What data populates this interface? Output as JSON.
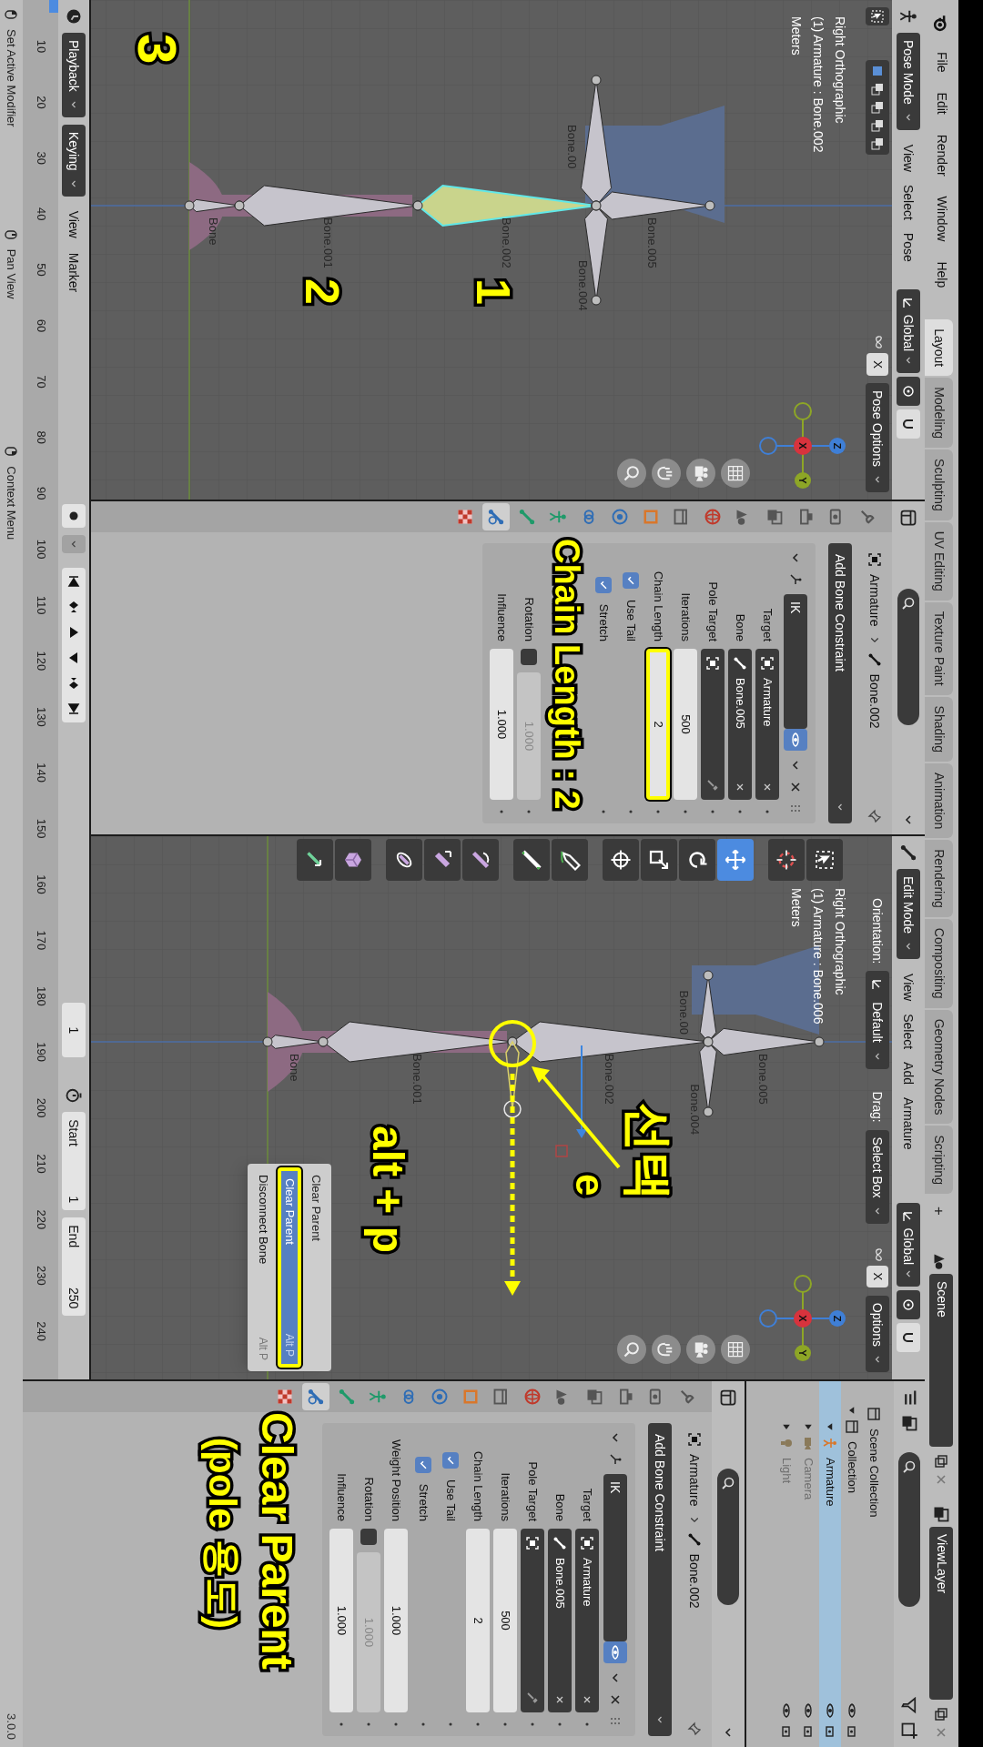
{
  "top_bar": {
    "menus": [
      "File",
      "Edit",
      "Render",
      "Window",
      "Help"
    ],
    "workspaces": [
      {
        "label": "Layout",
        "selected": true
      },
      {
        "label": "Modeling",
        "selected": false
      },
      {
        "label": "Sculpting",
        "selected": false
      },
      {
        "label": "UV Editing",
        "selected": false
      },
      {
        "label": "Texture Paint",
        "selected": false
      },
      {
        "label": "Shading",
        "selected": false
      },
      {
        "label": "Animation",
        "selected": false
      },
      {
        "label": "Rendering",
        "selected": false
      },
      {
        "label": "Compositing",
        "selected": false
      },
      {
        "label": "Geometry Nodes",
        "selected": false
      },
      {
        "label": "Scripting",
        "selected": false
      }
    ],
    "add_workspace": "+",
    "scene": "Scene",
    "view_layer": "ViewLayer"
  },
  "viewports": [
    {
      "mode": "Pose Mode",
      "menus": [
        "View",
        "Select",
        "Pose"
      ],
      "orientation": "Global",
      "mirror": "X",
      "options": "Pose Options",
      "overlay": [
        "Right Orthographic",
        "(1) Armature : Bone.002",
        "Meters"
      ],
      "bones": [
        {
          "label": "Bone",
          "selected": false
        },
        {
          "label": "Bone.001",
          "selected": false
        },
        {
          "label": "Bone.002",
          "selected": true
        },
        {
          "label": "Bone.00",
          "selected": false
        },
        {
          "label": "Bone.004",
          "selected": false
        },
        {
          "label": "Bone.005",
          "selected": false
        }
      ],
      "extruded_bone": false,
      "gizmo": [
        "X",
        "Y",
        "Z"
      ]
    },
    {
      "mode": "Edit Mode",
      "menus": [
        "View",
        "Select",
        "Add",
        "Armature"
      ],
      "orientation": "Global",
      "mirror": "X",
      "options": "Options",
      "tool_settings": {
        "orientation_label": "Orientation:",
        "orientation": "Default",
        "drag_label": "Drag:",
        "drag": "Select Box"
      },
      "overlay": [
        "Right Orthographic",
        "(1) Armature : Bone.006",
        "Meters"
      ],
      "bones": [
        {
          "label": "Bone",
          "selected": false
        },
        {
          "label": "Bone.001",
          "selected": false
        },
        {
          "label": "Bone.002",
          "selected": false
        },
        {
          "label": "Bone.00",
          "selected": false
        },
        {
          "label": "Bone.004",
          "selected": false
        },
        {
          "label": "Bone.005",
          "selected": false
        }
      ],
      "extruded_bone": true,
      "gizmo": [
        "X",
        "Y",
        "Z"
      ],
      "toolbar": [
        {
          "kind": "select",
          "selected": false
        },
        {
          "kind": "cursor",
          "selected": false
        },
        {
          "kind": "move",
          "selected": true
        },
        {
          "kind": "rotate",
          "selected": false
        },
        {
          "kind": "scale",
          "selected": false
        },
        {
          "kind": "transform",
          "selected": false
        },
        {
          "kind": "annotate",
          "selected": false
        },
        {
          "kind": "measure",
          "selected": false
        },
        {
          "kind": "roll",
          "selected": false
        },
        {
          "kind": "bone_size",
          "selected": false
        },
        {
          "kind": "envelope",
          "selected": false
        },
        {
          "kind": "extrude",
          "selected": false
        },
        {
          "kind": "extrude_cursor",
          "selected": false
        }
      ],
      "popup": {
        "title": "Clear Parent",
        "items": [
          {
            "label": "Clear Parent",
            "shortcut": "Alt P",
            "selected": true,
            "highlighted": true
          },
          {
            "label": "Disconnect Bone",
            "shortcut": "Alt P",
            "selected": false,
            "highlighted": false
          }
        ]
      }
    }
  ],
  "properties": [
    {
      "breadcrumb": [
        "Armature",
        "Bone.002"
      ],
      "add_button": "Add Bone Constraint",
      "constraint_name": "IK",
      "tabs": [
        {
          "kind": "tool",
          "selected": false
        },
        {
          "kind": "render",
          "selected": false
        },
        {
          "kind": "output",
          "selected": false
        },
        {
          "kind": "view_layer",
          "selected": false
        },
        {
          "kind": "scene",
          "selected": false
        },
        {
          "kind": "world",
          "selected": false
        },
        {
          "kind": "collection",
          "selected": false
        },
        {
          "kind": "object",
          "selected": false
        },
        {
          "kind": "physics",
          "selected": false
        },
        {
          "kind": "object_constraint",
          "selected": false
        },
        {
          "kind": "data",
          "selected": false
        },
        {
          "kind": "bone",
          "selected": false
        },
        {
          "kind": "bone_constraint",
          "selected": true
        },
        {
          "kind": "texture",
          "selected": false
        }
      ],
      "fields": [
        {
          "kind": "object",
          "label": "Target",
          "value": "Armature",
          "highlighted": false
        },
        {
          "kind": "bone",
          "label": "Bone",
          "value": "Bone.005",
          "highlighted": false
        },
        {
          "kind": "object",
          "label": "Pole Target",
          "highlighted": false
        },
        {
          "kind": "number",
          "label": "Iterations",
          "value": "500",
          "highlighted": false
        },
        {
          "kind": "number",
          "label": "Chain Length",
          "value": "2",
          "highlighted": true
        },
        {
          "kind": "check",
          "label": "Use Tail",
          "checked": true
        },
        {
          "kind": "check",
          "label": "Stretch",
          "checked": true
        },
        {
          "kind": "check_number",
          "label": "Rotation",
          "checked": false,
          "value": "1.000",
          "disabled": true
        },
        {
          "kind": "number",
          "label": "Influence",
          "value": "1.000",
          "highlighted": false
        }
      ]
    },
    {
      "breadcrumb": [
        "Armature",
        "Bone.002"
      ],
      "add_button": "Add Bone Constraint",
      "constraint_name": "IK",
      "tabs": [
        {
          "kind": "tool",
          "selected": false
        },
        {
          "kind": "render",
          "selected": false
        },
        {
          "kind": "output",
          "selected": false
        },
        {
          "kind": "view_layer",
          "selected": false
        },
        {
          "kind": "scene",
          "selected": false
        },
        {
          "kind": "world",
          "selected": false
        },
        {
          "kind": "collection",
          "selected": false
        },
        {
          "kind": "object",
          "selected": false
        },
        {
          "kind": "physics",
          "selected": false
        },
        {
          "kind": "object_constraint",
          "selected": false
        },
        {
          "kind": "data",
          "selected": false
        },
        {
          "kind": "bone",
          "selected": false
        },
        {
          "kind": "bone_constraint",
          "selected": true
        },
        {
          "kind": "texture",
          "selected": false
        }
      ],
      "fields": [
        {
          "kind": "object",
          "label": "Target",
          "value": "Armature",
          "highlighted": false
        },
        {
          "kind": "bone",
          "label": "Bone",
          "value": "Bone.005",
          "highlighted": false
        },
        {
          "kind": "object",
          "label": "Pole Target",
          "highlighted": false
        },
        {
          "kind": "number",
          "label": "Iterations",
          "value": "500",
          "highlighted": false
        },
        {
          "kind": "number",
          "label": "Chain Length",
          "value": "2",
          "highlighted": false
        },
        {
          "kind": "check",
          "label": "Use Tail",
          "checked": true
        },
        {
          "kind": "check",
          "label": "Stretch",
          "checked": true
        },
        {
          "kind": "number",
          "label": "Weight Position",
          "value": "1.000",
          "highlighted": false
        },
        {
          "kind": "check_number",
          "label": "Rotation",
          "checked": false,
          "value": "1.000",
          "disabled": true
        },
        {
          "kind": "number",
          "label": "Influence",
          "value": "1.000",
          "highlighted": false
        }
      ]
    }
  ],
  "outliner": {
    "tree": [
      {
        "label": "Scene Collection",
        "children": [
          {
            "label": "Collection",
            "expanded": true,
            "children": [
              {
                "label": "Armature",
                "expanded": true,
                "selected": true,
                "disabled": false
              },
              {
                "label": "Camera",
                "expanded": false,
                "selected": false,
                "disabled": true
              },
              {
                "label": "Light",
                "expanded": false,
                "selected": false,
                "disabled": true
              }
            ]
          }
        ]
      }
    ]
  },
  "timeline": {
    "menus": [
      "Playback",
      "Keying",
      "View",
      "Marker"
    ],
    "current_frame": "1",
    "start_label": "Start",
    "start": "1",
    "end_label": "End",
    "end": "250",
    "ruler": [
      "10",
      "20",
      "30",
      "40",
      "50",
      "60",
      "70",
      "80",
      "90",
      "100",
      "110",
      "120",
      "130",
      "140",
      "150",
      "160",
      "170",
      "180",
      "190",
      "200",
      "210",
      "220",
      "230",
      "240"
    ]
  },
  "status_bar": {
    "hints": [
      {
        "kind": "mouse_left",
        "label": "Set Active Modifier"
      },
      {
        "kind": "mouse_middle",
        "label": "Pan View"
      },
      {
        "kind": "mouse_right",
        "label": "Context Menu"
      }
    ],
    "version": "3.0.0"
  },
  "annotations": [
    {
      "text": "3"
    },
    {
      "text": "2"
    },
    {
      "text": "1"
    },
    {
      "text": "Chain Length : 2"
    },
    {
      "text": "선택"
    },
    {
      "text": "e"
    },
    {
      "text": "alt + p"
    },
    {
      "text": "Clear Parent"
    },
    {
      "text": "(pole 용도)"
    }
  ]
}
